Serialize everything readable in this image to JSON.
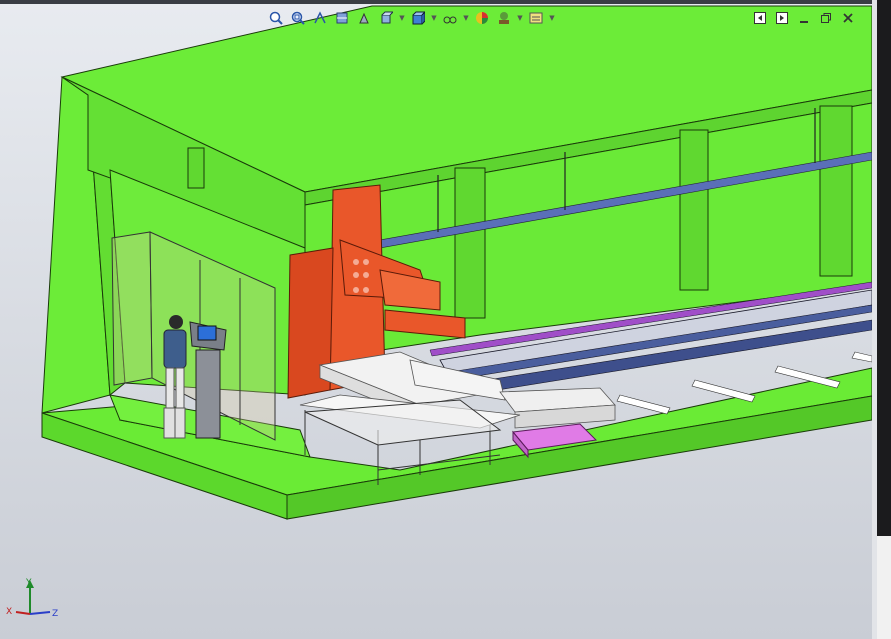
{
  "window": {
    "title": ""
  },
  "heads_up_toolbar": {
    "buttons": [
      {
        "name": "zoom-to-fit",
        "icon": "zoom-fit-icon"
      },
      {
        "name": "zoom-to-area",
        "icon": "zoom-area-icon"
      },
      {
        "name": "previous-view",
        "icon": "previous-view-icon"
      },
      {
        "name": "section-view",
        "icon": "section-view-icon"
      },
      {
        "name": "dynamic-annotation-views",
        "icon": "annotation-view-icon"
      },
      {
        "name": "view-orientation",
        "icon": "view-orientation-icon"
      },
      {
        "name": "display-style",
        "icon": "display-style-icon"
      },
      {
        "name": "hide-show-items",
        "icon": "hide-show-icon"
      },
      {
        "name": "edit-appearance",
        "icon": "appearance-icon"
      },
      {
        "name": "apply-scene",
        "icon": "scene-icon"
      },
      {
        "name": "view-settings",
        "icon": "view-settings-icon"
      }
    ]
  },
  "window_controls": {
    "buttons": [
      "previous-window-icon",
      "next-window-icon",
      "minimize-icon",
      "restore-icon",
      "close-icon"
    ]
  },
  "scene": {
    "colors": {
      "floor": "#6aeb35",
      "walls": "#6cec38",
      "edges": "#1a3a0a",
      "robot": "#e9572a",
      "beams": "#efefef",
      "pallet": "#e07be6",
      "rail": "#5a6fb8"
    }
  },
  "triad": {
    "x_label": "X",
    "y_label": "Y",
    "z_label": "Z"
  }
}
